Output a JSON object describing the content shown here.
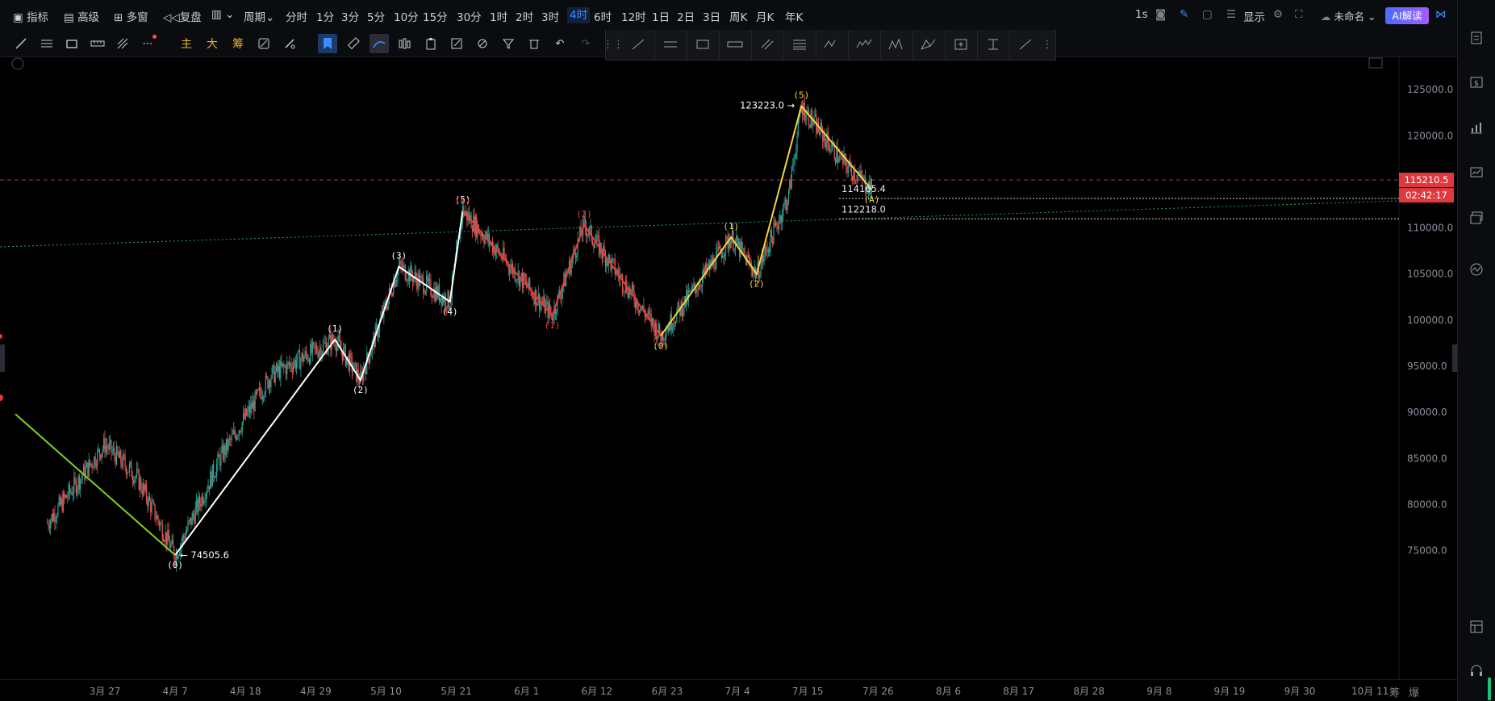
{
  "topbar": {
    "indicator": "指标",
    "advanced": "高级",
    "multiwin": "多窗",
    "replay": "复盘",
    "period": "周期",
    "intervals": [
      "分时",
      "1分",
      "3分",
      "5分",
      "10分",
      "15分",
      "30分",
      "1时",
      "2时",
      "3时",
      "4时",
      "6时",
      "12时",
      "1日",
      "2日",
      "3日",
      "周K",
      "月K",
      "年K"
    ],
    "active_interval": "4时",
    "refresh": "1s",
    "display": "显示",
    "layout_name": "未命名",
    "ai_button": "AI解读"
  },
  "toolbar": {
    "main_label": "主",
    "big_label": "大",
    "chip_label": "筹"
  },
  "chart_data": {
    "type": "candlestick",
    "symbol_interval": "4时",
    "y_axis": {
      "min": 72000,
      "max": 127000,
      "ticks": [
        75000,
        80000,
        85000,
        90000,
        95000,
        100000,
        105000,
        110000,
        115000,
        120000,
        125000
      ],
      "tick_labels": [
        "75000.0",
        "80000.0",
        "85000.0",
        "90000.0",
        "95000.0",
        "100000.0",
        "105000.0",
        "110000.0",
        "115000.0",
        "120000.0",
        "125000.0"
      ]
    },
    "x_axis": {
      "tick_labels": [
        "3月 27",
        "4月 7",
        "4月 18",
        "4月 29",
        "5月 10",
        "5月 21",
        "6月 1",
        "6月 12",
        "6月 23",
        "7月 4",
        "7月 15",
        "7月 26",
        "8月 6",
        "8月 17",
        "8月 28",
        "9月 8",
        "9月 19",
        "9月 30",
        "10月 11"
      ]
    },
    "current_price": {
      "value": 115210.5,
      "label": "115210.5",
      "countdown": "02:42:17"
    },
    "annotations": {
      "low_label": "74505.6",
      "high_label": "123223.0",
      "level_1": "114165.4",
      "level_2": "112218.0"
    },
    "price_path_anchors": [
      {
        "date": "3月 18",
        "price": 78000
      },
      {
        "date": "3月 27",
        "price": 86500
      },
      {
        "date": "4月 1",
        "price": 83000
      },
      {
        "date": "4月 7",
        "price": 74505.6
      },
      {
        "date": "4月 14",
        "price": 85000
      },
      {
        "date": "4月 22",
        "price": 94000
      },
      {
        "date": "5月 2",
        "price": 97900
      },
      {
        "date": "5月 6",
        "price": 93500
      },
      {
        "date": "5月 12",
        "price": 105800
      },
      {
        "date": "5月 20",
        "price": 102000
      },
      {
        "date": "5月 22",
        "price": 111900
      },
      {
        "date": "6月 5",
        "price": 100500
      },
      {
        "date": "6月 10",
        "price": 110300
      },
      {
        "date": "6月 22",
        "price": 98300
      },
      {
        "date": "7月 3",
        "price": 109000
      },
      {
        "date": "7月 7",
        "price": 105000
      },
      {
        "date": "7月 12",
        "price": 113500
      },
      {
        "date": "7月 14",
        "price": 123223.0
      },
      {
        "date": "7月 20",
        "price": 117500
      },
      {
        "date": "7月 25",
        "price": 114165.4
      }
    ],
    "wave_labels": {
      "green": [
        {
          "date": "3月 13",
          "price": 89800
        },
        {
          "date": "4月 7",
          "price": 74505.6
        }
      ],
      "white": [
        {
          "label": "(0)",
          "date": "4月 7",
          "price": 74505.6
        },
        {
          "label": "(1)",
          "date": "5月 2",
          "price": 97900
        },
        {
          "label": "(2)",
          "date": "5月 6",
          "price": 93500
        },
        {
          "label": "(3)",
          "date": "5月 12",
          "price": 105800
        },
        {
          "label": "(4)",
          "date": "5月 20",
          "price": 102000
        },
        {
          "label": "(5)",
          "date": "5月 22",
          "price": 111900
        }
      ],
      "red": [
        {
          "label": "(1)",
          "date": "6月 5",
          "price": 100500
        },
        {
          "label": "(2)",
          "date": "6月 10",
          "price": 110300
        }
      ],
      "yellow": [
        {
          "label": "(0)",
          "date": "6月 22",
          "price": 98300
        },
        {
          "label": "(1)",
          "date": "7月 3",
          "price": 109000
        },
        {
          "label": "(2)",
          "date": "7月 7",
          "price": 105000
        },
        {
          "label": "(5)",
          "date": "7月 14",
          "price": 123223.0
        },
        {
          "label": "(A)",
          "date": "7月 25",
          "price": 114165.4
        }
      ]
    },
    "colors": {
      "up": "#26a69a",
      "down": "#ef5350",
      "wave_white": "#ffffff",
      "wave_red": "#ef3b3b",
      "wave_yellow": "#f5d442",
      "wave_green": "#7ed321",
      "price_tag": "#e0383e",
      "trendline": "#1fa38a"
    }
  },
  "bottom": {
    "right_a": "筹",
    "right_b": "爆"
  }
}
